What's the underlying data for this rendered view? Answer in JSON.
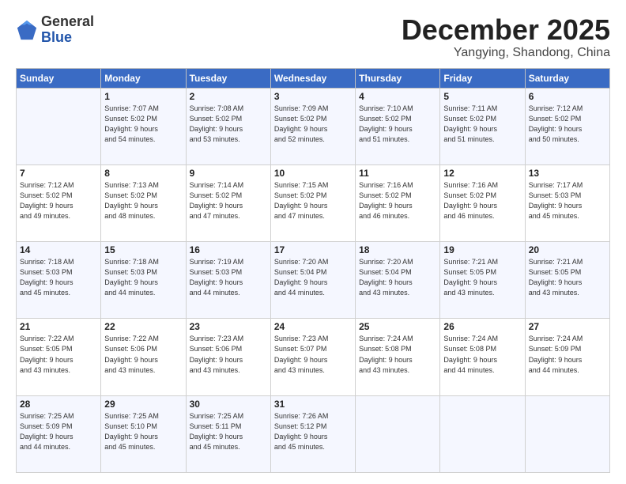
{
  "header": {
    "logo_general": "General",
    "logo_blue": "Blue",
    "month_title": "December 2025",
    "location": "Yangying, Shandong, China"
  },
  "weekdays": [
    "Sunday",
    "Monday",
    "Tuesday",
    "Wednesday",
    "Thursday",
    "Friday",
    "Saturday"
  ],
  "weeks": [
    [
      {
        "day": "",
        "info": ""
      },
      {
        "day": "1",
        "info": "Sunrise: 7:07 AM\nSunset: 5:02 PM\nDaylight: 9 hours\nand 54 minutes."
      },
      {
        "day": "2",
        "info": "Sunrise: 7:08 AM\nSunset: 5:02 PM\nDaylight: 9 hours\nand 53 minutes."
      },
      {
        "day": "3",
        "info": "Sunrise: 7:09 AM\nSunset: 5:02 PM\nDaylight: 9 hours\nand 52 minutes."
      },
      {
        "day": "4",
        "info": "Sunrise: 7:10 AM\nSunset: 5:02 PM\nDaylight: 9 hours\nand 51 minutes."
      },
      {
        "day": "5",
        "info": "Sunrise: 7:11 AM\nSunset: 5:02 PM\nDaylight: 9 hours\nand 51 minutes."
      },
      {
        "day": "6",
        "info": "Sunrise: 7:12 AM\nSunset: 5:02 PM\nDaylight: 9 hours\nand 50 minutes."
      }
    ],
    [
      {
        "day": "7",
        "info": "Sunrise: 7:12 AM\nSunset: 5:02 PM\nDaylight: 9 hours\nand 49 minutes."
      },
      {
        "day": "8",
        "info": "Sunrise: 7:13 AM\nSunset: 5:02 PM\nDaylight: 9 hours\nand 48 minutes."
      },
      {
        "day": "9",
        "info": "Sunrise: 7:14 AM\nSunset: 5:02 PM\nDaylight: 9 hours\nand 47 minutes."
      },
      {
        "day": "10",
        "info": "Sunrise: 7:15 AM\nSunset: 5:02 PM\nDaylight: 9 hours\nand 47 minutes."
      },
      {
        "day": "11",
        "info": "Sunrise: 7:16 AM\nSunset: 5:02 PM\nDaylight: 9 hours\nand 46 minutes."
      },
      {
        "day": "12",
        "info": "Sunrise: 7:16 AM\nSunset: 5:02 PM\nDaylight: 9 hours\nand 46 minutes."
      },
      {
        "day": "13",
        "info": "Sunrise: 7:17 AM\nSunset: 5:03 PM\nDaylight: 9 hours\nand 45 minutes."
      }
    ],
    [
      {
        "day": "14",
        "info": "Sunrise: 7:18 AM\nSunset: 5:03 PM\nDaylight: 9 hours\nand 45 minutes."
      },
      {
        "day": "15",
        "info": "Sunrise: 7:18 AM\nSunset: 5:03 PM\nDaylight: 9 hours\nand 44 minutes."
      },
      {
        "day": "16",
        "info": "Sunrise: 7:19 AM\nSunset: 5:03 PM\nDaylight: 9 hours\nand 44 minutes."
      },
      {
        "day": "17",
        "info": "Sunrise: 7:20 AM\nSunset: 5:04 PM\nDaylight: 9 hours\nand 44 minutes."
      },
      {
        "day": "18",
        "info": "Sunrise: 7:20 AM\nSunset: 5:04 PM\nDaylight: 9 hours\nand 43 minutes."
      },
      {
        "day": "19",
        "info": "Sunrise: 7:21 AM\nSunset: 5:05 PM\nDaylight: 9 hours\nand 43 minutes."
      },
      {
        "day": "20",
        "info": "Sunrise: 7:21 AM\nSunset: 5:05 PM\nDaylight: 9 hours\nand 43 minutes."
      }
    ],
    [
      {
        "day": "21",
        "info": "Sunrise: 7:22 AM\nSunset: 5:05 PM\nDaylight: 9 hours\nand 43 minutes."
      },
      {
        "day": "22",
        "info": "Sunrise: 7:22 AM\nSunset: 5:06 PM\nDaylight: 9 hours\nand 43 minutes."
      },
      {
        "day": "23",
        "info": "Sunrise: 7:23 AM\nSunset: 5:06 PM\nDaylight: 9 hours\nand 43 minutes."
      },
      {
        "day": "24",
        "info": "Sunrise: 7:23 AM\nSunset: 5:07 PM\nDaylight: 9 hours\nand 43 minutes."
      },
      {
        "day": "25",
        "info": "Sunrise: 7:24 AM\nSunset: 5:08 PM\nDaylight: 9 hours\nand 43 minutes."
      },
      {
        "day": "26",
        "info": "Sunrise: 7:24 AM\nSunset: 5:08 PM\nDaylight: 9 hours\nand 44 minutes."
      },
      {
        "day": "27",
        "info": "Sunrise: 7:24 AM\nSunset: 5:09 PM\nDaylight: 9 hours\nand 44 minutes."
      }
    ],
    [
      {
        "day": "28",
        "info": "Sunrise: 7:25 AM\nSunset: 5:09 PM\nDaylight: 9 hours\nand 44 minutes."
      },
      {
        "day": "29",
        "info": "Sunrise: 7:25 AM\nSunset: 5:10 PM\nDaylight: 9 hours\nand 45 minutes."
      },
      {
        "day": "30",
        "info": "Sunrise: 7:25 AM\nSunset: 5:11 PM\nDaylight: 9 hours\nand 45 minutes."
      },
      {
        "day": "31",
        "info": "Sunrise: 7:26 AM\nSunset: 5:12 PM\nDaylight: 9 hours\nand 45 minutes."
      },
      {
        "day": "",
        "info": ""
      },
      {
        "day": "",
        "info": ""
      },
      {
        "day": "",
        "info": ""
      }
    ]
  ]
}
